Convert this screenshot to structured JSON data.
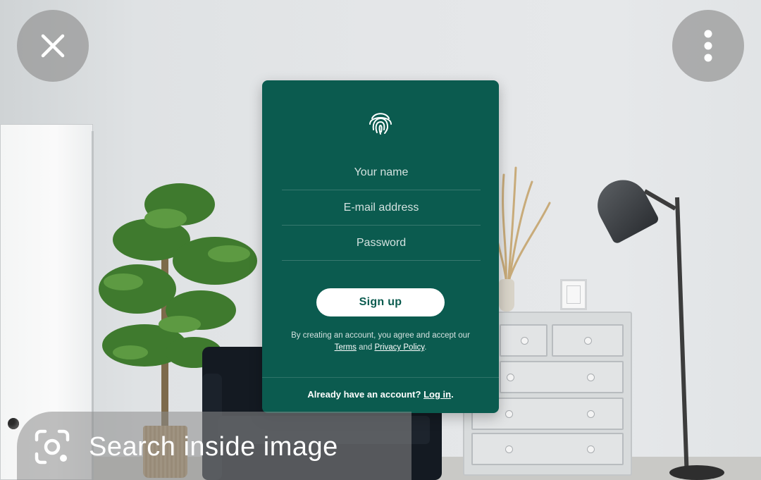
{
  "overlay": {
    "close_icon": "close-icon",
    "more_icon": "more-vertical-icon",
    "search_label": "Search inside image",
    "lens_icon": "lens-icon"
  },
  "signup_card": {
    "brand_icon": "fingerprint-icon",
    "name_placeholder": "Your name",
    "email_placeholder": "E-mail address",
    "password_placeholder": "Password",
    "signup_label": "Sign up",
    "legal_prefix": "By creating an account, you agree and accept our",
    "terms_label": "Terms",
    "legal_and": "and",
    "privacy_label": "Privacy Policy",
    "legal_suffix": ".",
    "login_prompt": "Already have an account?",
    "login_label": "Log in",
    "login_suffix": ".",
    "background_color": "#0b5b4f"
  }
}
